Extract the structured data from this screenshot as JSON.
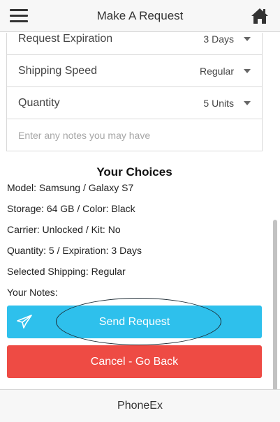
{
  "header": {
    "title": "Make A Request",
    "menu_icon": "hamburger-menu-icon",
    "home_icon": "home-icon"
  },
  "form": {
    "rows": [
      {
        "label": "Request Expiration",
        "value": "3 Days"
      },
      {
        "label": "Shipping Speed",
        "value": "Regular"
      },
      {
        "label": "Quantity",
        "value": "5 Units"
      }
    ],
    "notes_placeholder": "Enter any notes you may have"
  },
  "choices": {
    "title": "Your Choices",
    "lines": [
      "Model: Samsung / Galaxy S7",
      "Storage: 64 GB / Color: Black",
      "Carrier: Unlocked / Kit: No",
      "Quantity: 5 / Expiration: 3 Days",
      "Selected Shipping: Regular",
      "Your Notes:"
    ]
  },
  "actions": {
    "send_label": "Send Request",
    "send_icon": "paper-plane-icon",
    "cancel_label": "Cancel - Go Back"
  },
  "footer": {
    "brand": "PhoneEx"
  },
  "colors": {
    "send": "#2ec0ec",
    "cancel": "#ee4b44"
  }
}
